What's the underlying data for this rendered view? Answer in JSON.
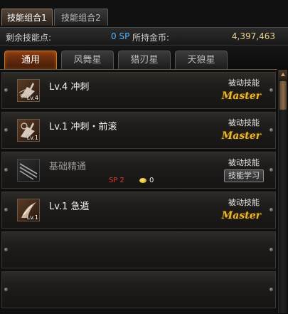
{
  "top_tabs": [
    {
      "label": "技能组合1",
      "active": true
    },
    {
      "label": "技能组合2",
      "active": false
    }
  ],
  "info": {
    "sp_label": "剩余技能点:",
    "sp_value": "0 SP",
    "gold_label": "所持金币:",
    "gold_value": "4,397,463"
  },
  "sub_tabs": [
    {
      "label": "通用",
      "active": true
    },
    {
      "label": "风舞星",
      "active": false
    },
    {
      "label": "猎刃星",
      "active": false
    },
    {
      "label": "天狼星",
      "active": false
    }
  ],
  "skills": [
    {
      "icon": "dash-skill-icon",
      "badge": "Lv.4",
      "name": "Lv.4 冲刺",
      "type": "被动技能",
      "status": "Master"
    },
    {
      "icon": "dash-roll-skill-icon",
      "badge": "Lv.1",
      "name": "Lv.1 冲刺・前滚",
      "type": "被动技能",
      "status": "Master"
    },
    {
      "icon": "basic-mastery-skill-icon",
      "name": "基础精通",
      "type": "被动技能",
      "sp_cost": "SP 2",
      "gold_cost": "0",
      "learn_label": "技能学习"
    },
    {
      "icon": "rush-skill-icon",
      "badge": "Lv.1",
      "name": "Lv.1 急遁",
      "type": "被动技能",
      "status": "Master"
    }
  ],
  "colors": {
    "sp_value": "#4fb4ff",
    "master": "#e8b830",
    "sp_cost": "#e23a2a",
    "active_tab": "#8a3b12"
  }
}
